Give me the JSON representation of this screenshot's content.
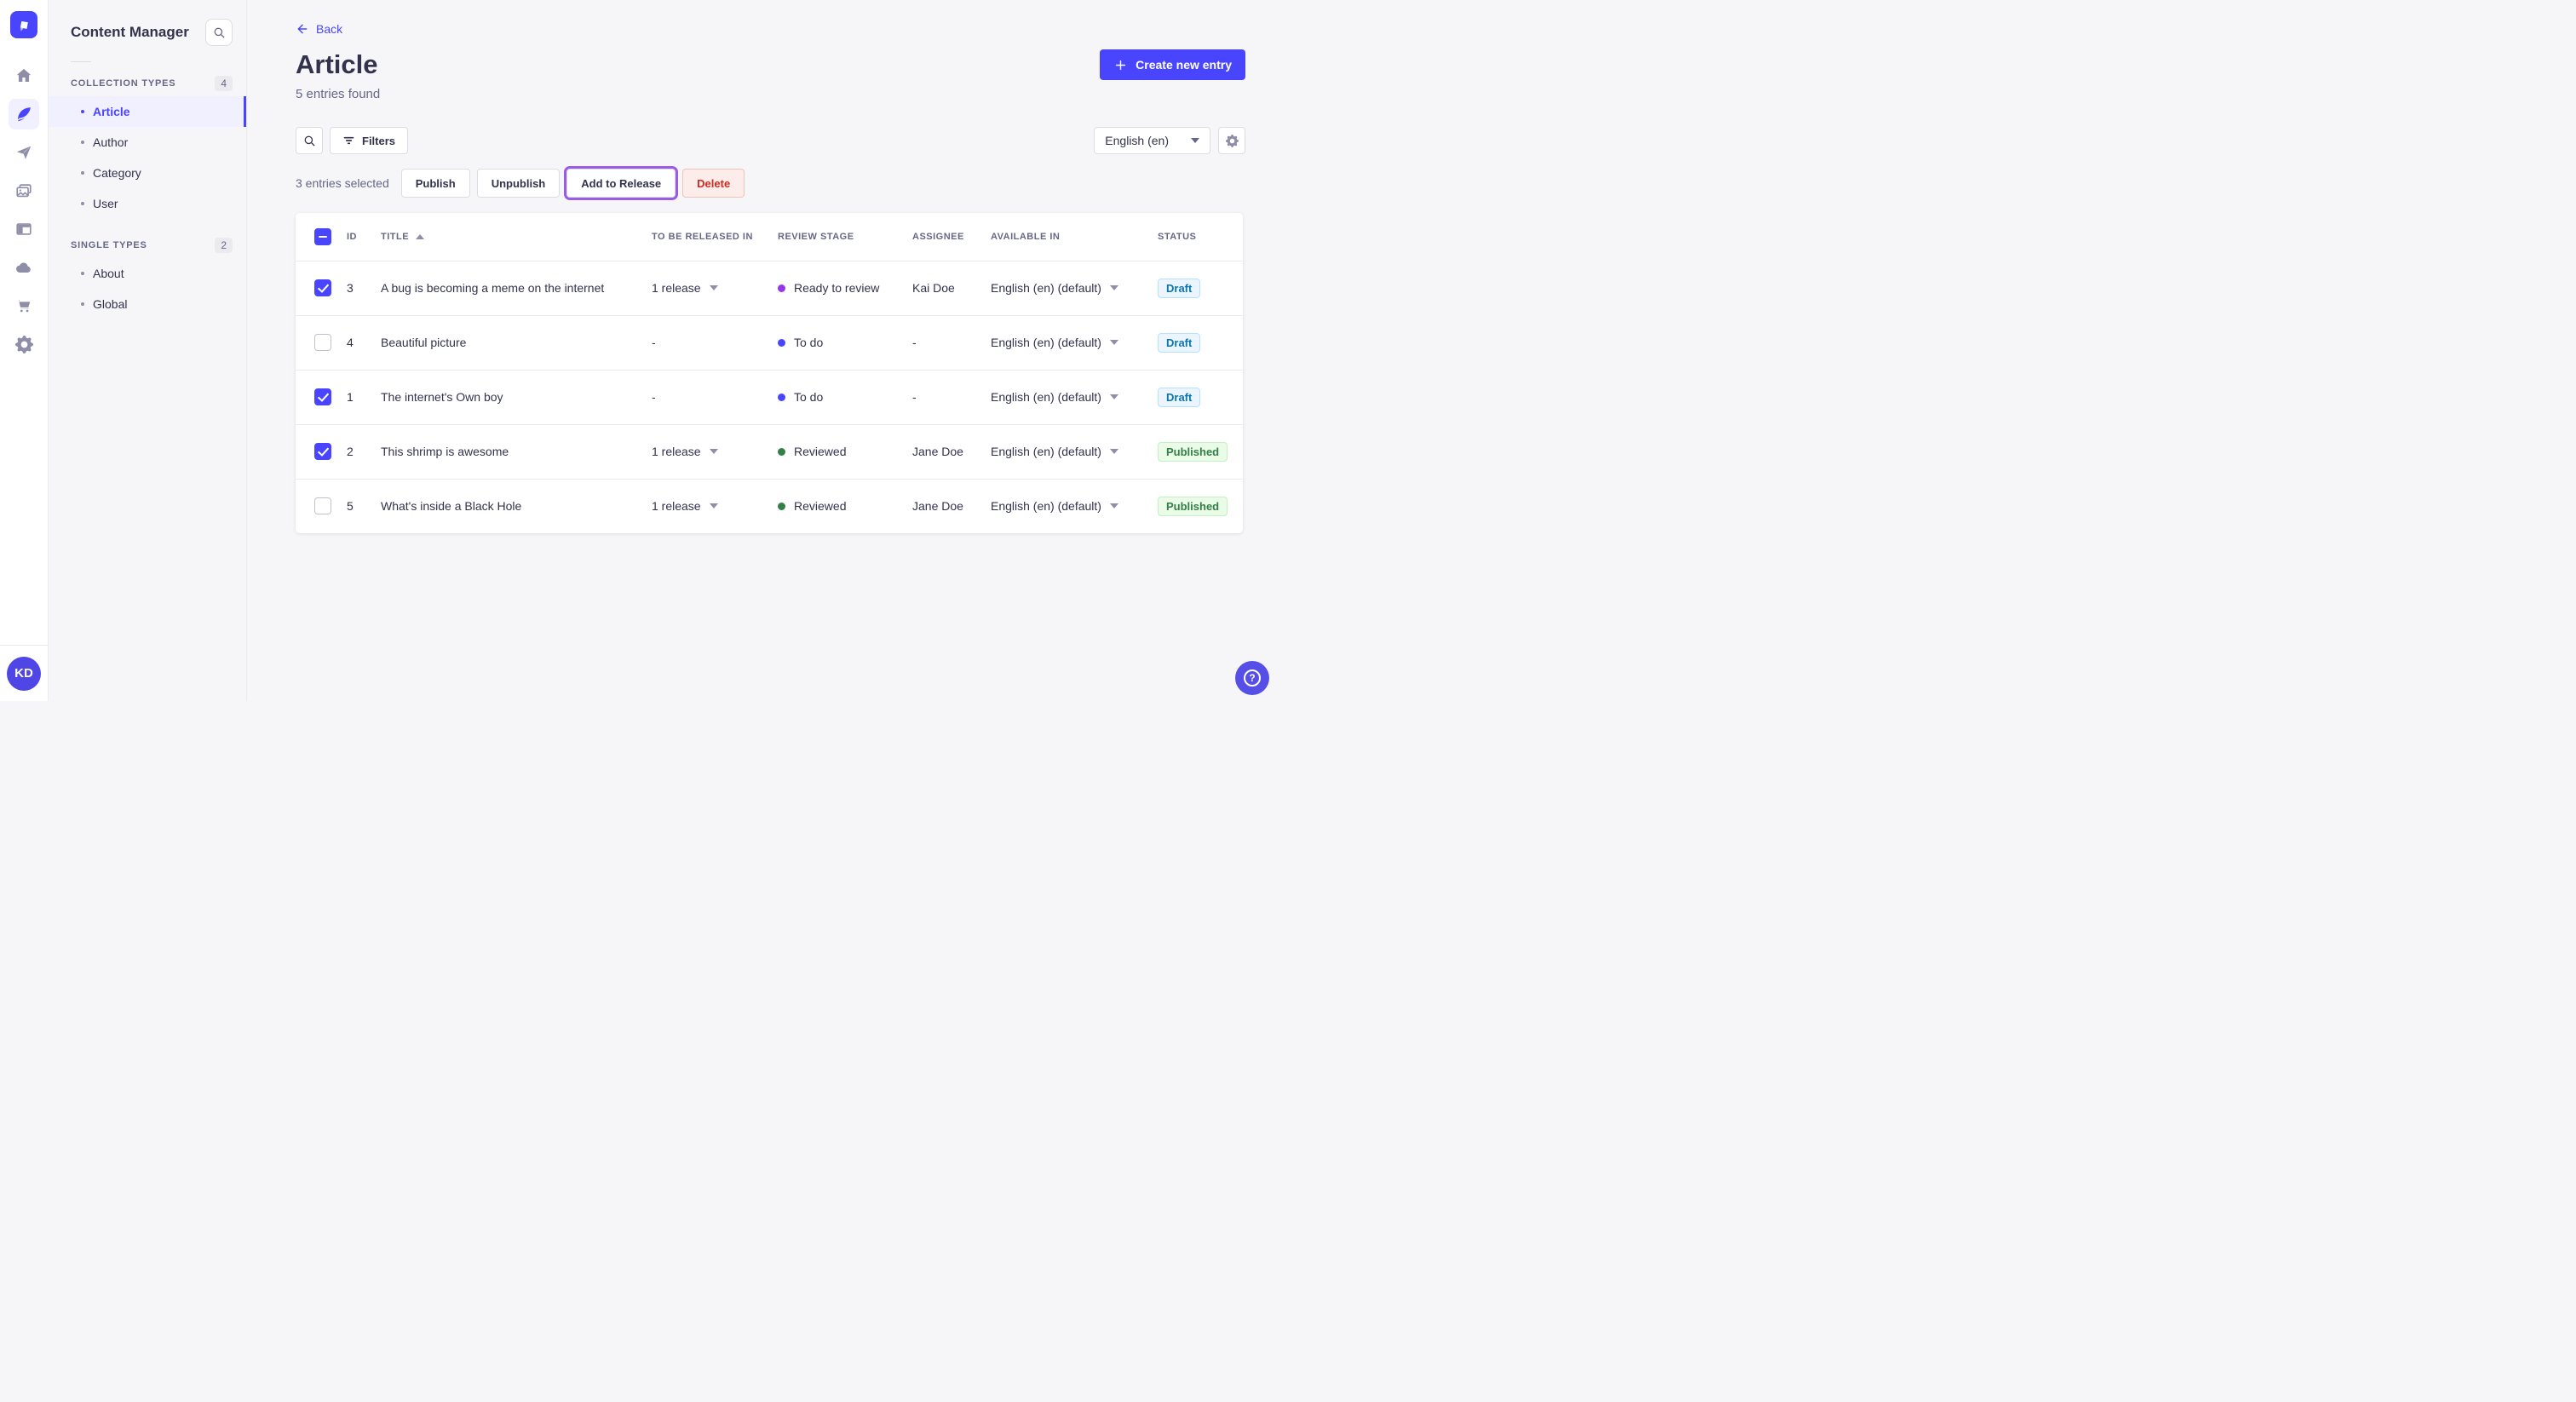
{
  "colors": {
    "primary": "#4945ff",
    "highlight_outline": "#9b5be4",
    "stage_ready_to_review": "#9736e8",
    "stage_to_do": "#4945ff",
    "stage_reviewed": "#328048",
    "status_draft_text": "#0c75af",
    "status_published_text": "#328048",
    "delete_text": "#d02b20"
  },
  "rail": {
    "icons": [
      "home",
      "feather",
      "paper-plane",
      "media",
      "layout",
      "cloud",
      "cart",
      "gear"
    ],
    "avatar_initials": "KD"
  },
  "subnav": {
    "title": "Content Manager",
    "sections": [
      {
        "label": "COLLECTION TYPES",
        "count": "4",
        "items": [
          {
            "label": "Article"
          },
          {
            "label": "Author"
          },
          {
            "label": "Category"
          },
          {
            "label": "User"
          }
        ]
      },
      {
        "label": "SINGLE TYPES",
        "count": "2",
        "items": [
          {
            "label": "About"
          },
          {
            "label": "Global"
          }
        ]
      }
    ]
  },
  "header": {
    "back": "Back",
    "title": "Article",
    "subtitle": "5 entries found",
    "create": "Create new entry"
  },
  "toolbar": {
    "filters": "Filters",
    "locale": "English (en)"
  },
  "selection": {
    "text": "3 entries selected",
    "publish": "Publish",
    "unpublish": "Unpublish",
    "add_to_release": "Add to Release",
    "delete": "Delete"
  },
  "table": {
    "columns": [
      "ID",
      "TITLE",
      "TO BE RELEASED IN",
      "REVIEW STAGE",
      "ASSIGNEE",
      "AVAILABLE IN",
      "STATUS"
    ],
    "rows": [
      {
        "checked": true,
        "id": "3",
        "title": "A bug is becoming a meme on the internet",
        "release": "1 release",
        "stage": "Ready to review",
        "stage_color": "#9736e8",
        "assignee": "Kai Doe",
        "locale": "English (en) (default)",
        "status": "Draft"
      },
      {
        "checked": false,
        "id": "4",
        "title": "Beautiful picture",
        "release": "-",
        "stage": "To do",
        "stage_color": "#4945ff",
        "assignee": "-",
        "locale": "English (en) (default)",
        "status": "Draft"
      },
      {
        "checked": true,
        "id": "1",
        "title": "The internet's Own boy",
        "release": "-",
        "stage": "To do",
        "stage_color": "#4945ff",
        "assignee": "-",
        "locale": "English (en) (default)",
        "status": "Draft"
      },
      {
        "checked": true,
        "id": "2",
        "title": "This shrimp is awesome",
        "release": "1 release",
        "stage": "Reviewed",
        "stage_color": "#328048",
        "assignee": "Jane Doe",
        "locale": "English (en) (default)",
        "status": "Published"
      },
      {
        "checked": false,
        "id": "5",
        "title": "What's inside a Black Hole",
        "release": "1 release",
        "stage": "Reviewed",
        "stage_color": "#328048",
        "assignee": "Jane Doe",
        "locale": "English (en) (default)",
        "status": "Published"
      }
    ]
  }
}
